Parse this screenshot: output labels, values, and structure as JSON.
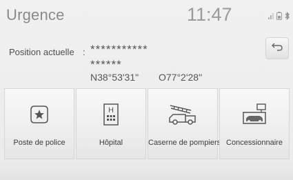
{
  "header": {
    "title": "Urgence",
    "clock": "11:47",
    "status_icons": [
      "signal-icon",
      "phone-battery-icon",
      "bluetooth-icon"
    ]
  },
  "location": {
    "label": "Position actuelle",
    "separator": ":",
    "line1": "***********",
    "line2": "******",
    "latitude": "N38°53'31\"",
    "longitude": "O77°2'28\""
  },
  "back_button": {
    "icon": "return-arrow-icon"
  },
  "categories": [
    {
      "label": "Poste de police",
      "icon": "police-badge-icon"
    },
    {
      "label": "Hôpital",
      "icon": "hospital-icon"
    },
    {
      "label": "Caserne de pompiers",
      "icon": "fire-truck-icon"
    },
    {
      "label": "Concessionnaire",
      "icon": "car-dealer-icon"
    }
  ]
}
